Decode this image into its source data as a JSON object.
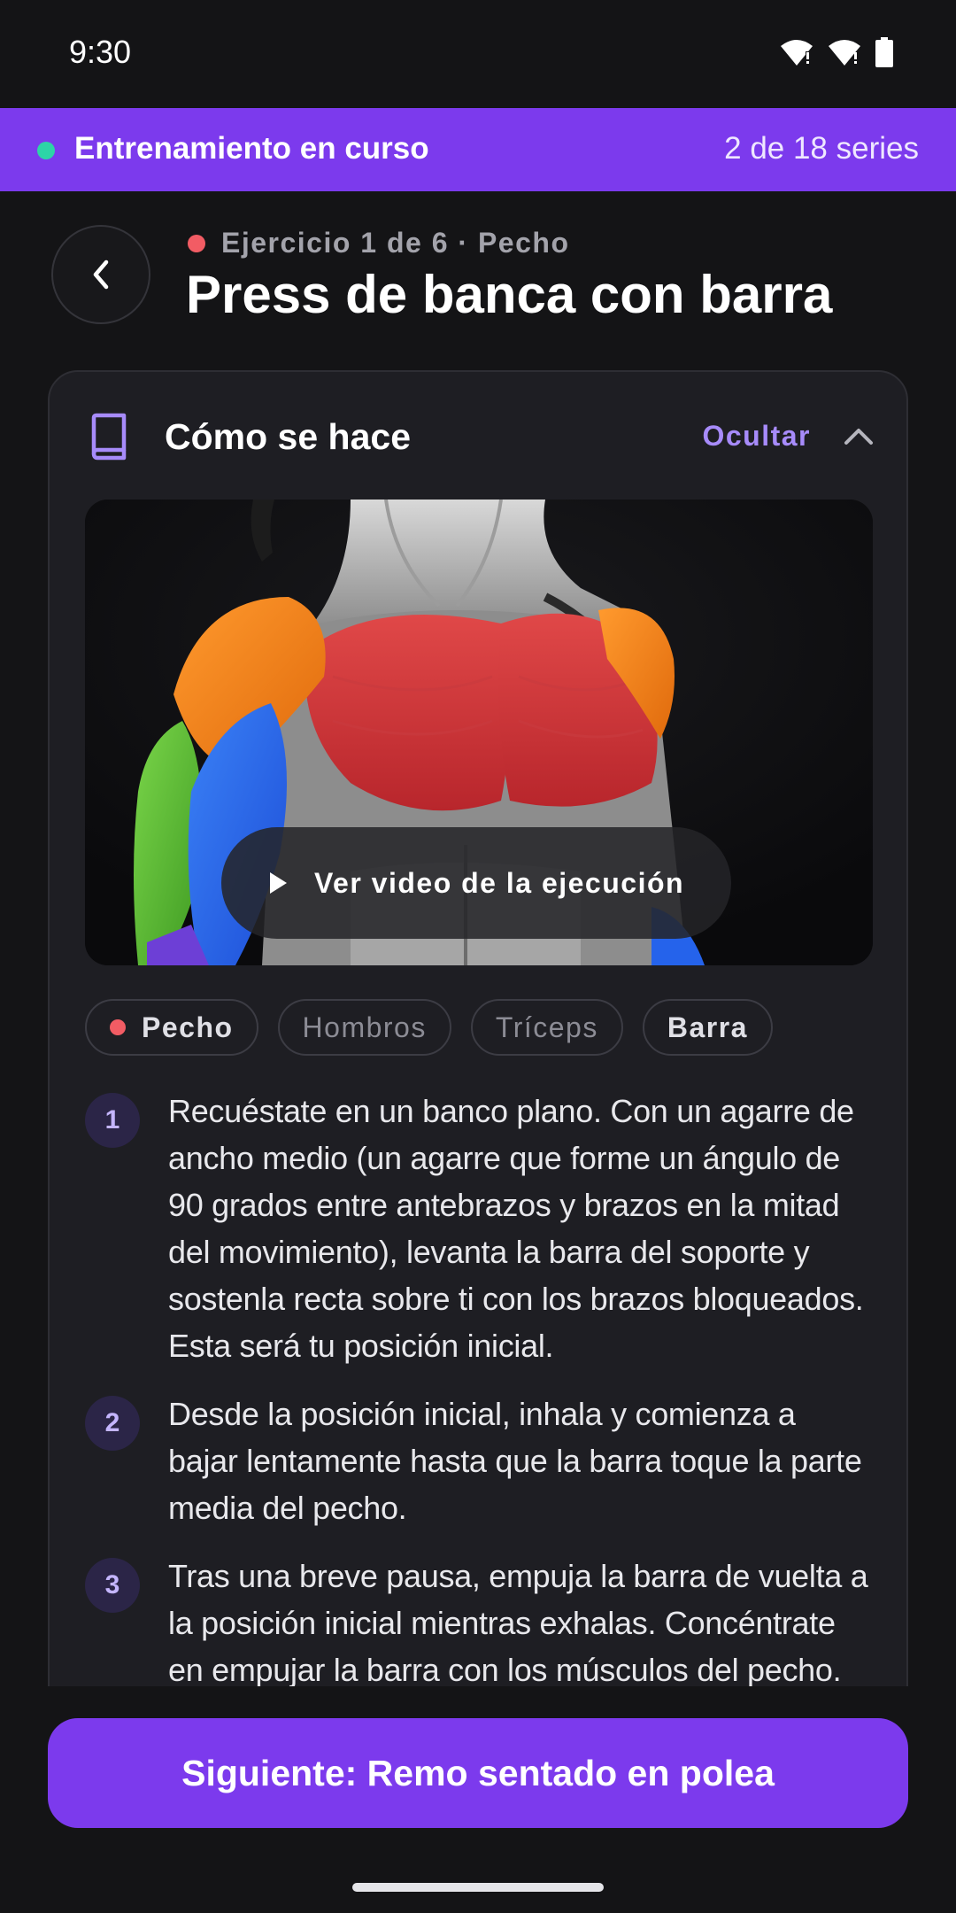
{
  "status_bar": {
    "time": "9:30"
  },
  "banner": {
    "title": "Entrenamiento en curso",
    "progress": "2 de 18 series",
    "live_dot_color": "#2dd4a7",
    "background": "#7c3aed"
  },
  "header": {
    "meta": "Ejercicio 1 de 6 · Pecho",
    "meta_dot_color": "#f25c64",
    "title": "Press de banca con barra"
  },
  "how_to": {
    "title": "Cómo se hace",
    "hide_label": "Ocultar",
    "video_label": "Ver video de la ejecución",
    "chips": [
      {
        "label": "Pecho",
        "primary": true,
        "dot_color": "#f25c64"
      },
      {
        "label": "Hombros",
        "primary": false
      },
      {
        "label": "Tríceps",
        "primary": false
      },
      {
        "label": "Barra",
        "primary": true
      }
    ],
    "steps": [
      {
        "number": "1",
        "text": "Recuéstate en un banco plano. Con un agarre de ancho medio (un agarre que forme un ángulo de 90 grados entre antebrazos y brazos en la mitad del movimiento), levanta la barra del soporte y sostenla recta sobre ti con los brazos bloqueados. Esta será tu posición inicial."
      },
      {
        "number": "2",
        "text": "Desde la posición inicial, inhala y comienza a bajar lentamente hasta que la barra toque la parte media del pecho."
      },
      {
        "number": "3",
        "text": "Tras una breve pausa, empuja la barra de vuelta a la posición inicial mientras exhalas. Concéntrate en empujar la barra con los músculos del pecho."
      }
    ]
  },
  "next_button": {
    "label": "Siguiente: Remo sentado en polea"
  },
  "colors": {
    "accent": "#7c3aed",
    "accent_light": "#a78bfa",
    "background": "#141416",
    "card": "#1e1e23"
  }
}
